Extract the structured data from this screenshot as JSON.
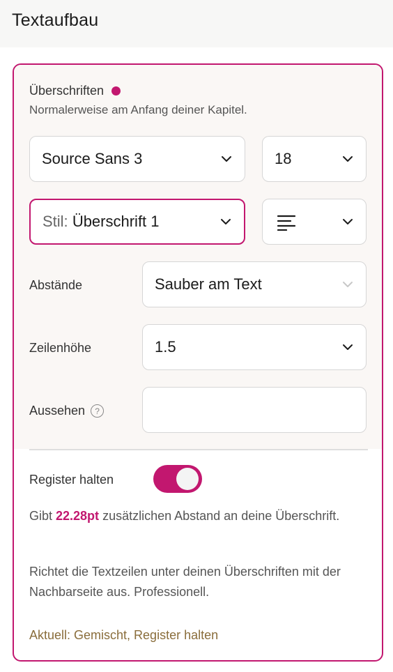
{
  "header": {
    "title": "Textaufbau"
  },
  "section": {
    "heading": "Überschriften",
    "subtext": "Normalerweise am Anfang deiner Kapitel."
  },
  "font": {
    "value": "Source Sans 3"
  },
  "size": {
    "value": "18"
  },
  "style": {
    "prefix": "Stil:",
    "value": "Überschrift 1"
  },
  "alignment": {
    "icon": "align-left-icon"
  },
  "spacing": {
    "label": "Abstände",
    "value": "Sauber am Text"
  },
  "line_height": {
    "label": "Zeilenhöhe",
    "value": "1.5"
  },
  "appearance": {
    "label": "Aussehen",
    "help": "?",
    "value": ""
  },
  "register": {
    "label": "Register halten",
    "enabled": true,
    "info_prefix": "Gibt ",
    "info_value": "22.28pt",
    "info_suffix": " zusätzlichen Abstand an deine Überschrift.",
    "description": "Richtet die Textzeilen unter deinen Überschriften mit der Nachbarseite aus. Professionell.",
    "status": "Aktuell: Gemischt, Register halten"
  },
  "colors": {
    "accent": "#c2176f",
    "status_text": "#8a6d3b"
  }
}
